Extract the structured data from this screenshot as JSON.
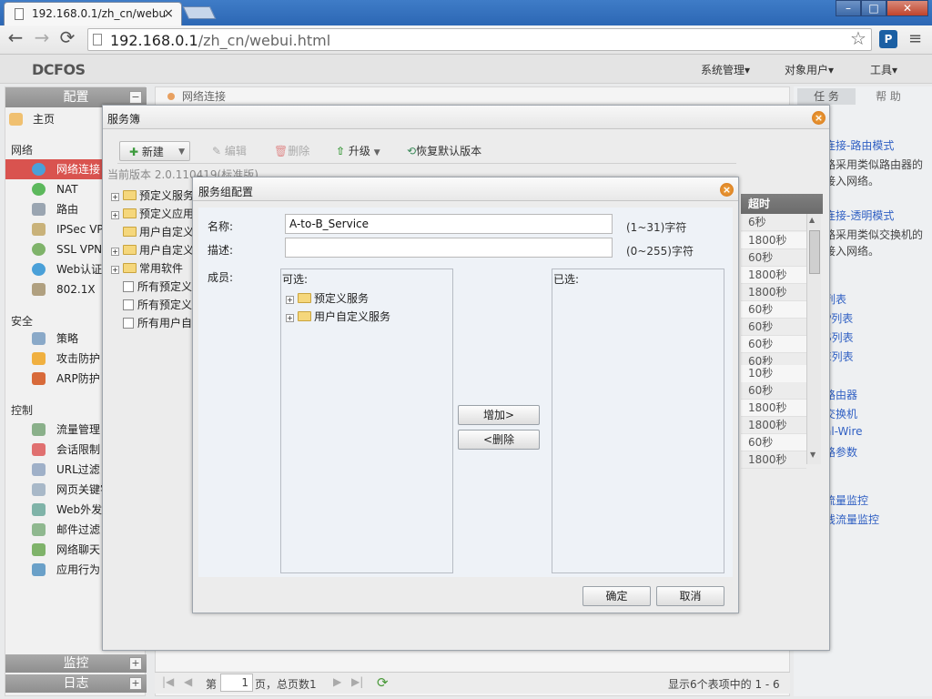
{
  "browser": {
    "tab_title": "192.168.0.1/zh_cn/webu",
    "url_host": "192.168.0.1",
    "url_path": "/zh_cn/webui.html",
    "back_icon": "←",
    "forward_icon": "→",
    "reload_icon": "⟳",
    "tab_close": "×",
    "star_icon": "☆",
    "menu_icon": "≡",
    "win_min": "–",
    "win_max": "□",
    "win_close": "✕"
  },
  "app": {
    "logo": "DCFOS",
    "top_menu": [
      "系统管理▾",
      "对象用户▾",
      "工具▾"
    ]
  },
  "left_panel": {
    "header": "配置",
    "home": "主页",
    "sections": {
      "network": "网络",
      "security": "安全",
      "control": "控制"
    },
    "network_items": [
      "网络连接",
      "NAT",
      "路由",
      "IPSec VPN",
      "SSL VPN",
      "Web认证",
      "802.1X"
    ],
    "security_items": [
      "策略",
      "攻击防护",
      "ARP防护"
    ],
    "control_items": [
      "流量管理",
      "会话限制",
      "URL过滤",
      "网页关键字",
      "Web外发",
      "邮件过滤",
      "网络聊天",
      "应用行为"
    ],
    "footer_monitor": "监控",
    "footer_log": "日志",
    "plus": "+",
    "minus": "−"
  },
  "center": {
    "breadcrumb": "网络连接",
    "pager": {
      "page_prefix": "第",
      "page_value": "1",
      "page_suffix": "页，总页数1",
      "summary": "显示6个表项中的 1 - 6"
    }
  },
  "right_panel": {
    "tab_tasks": "任 务",
    "tab_help": "帮 助",
    "lines": [
      {
        "text": "连接-路由模式",
        "link": true
      },
      {
        "text": "路采用类似路由器的",
        "link": false
      },
      {
        "text": "接入网络。",
        "link": false
      },
      {
        "text": "连接-透明模式",
        "link": true
      },
      {
        "text": "路采用类似交换机的",
        "link": false
      },
      {
        "text": "接入网络。",
        "link": false
      },
      {
        "text": "列表",
        "link": true
      },
      {
        "text": "P列表",
        "link": true
      },
      {
        "text": "S列表",
        "link": true
      },
      {
        "text": "E列表",
        "link": true
      },
      {
        "text": "路由器",
        "link": true
      },
      {
        "text": "交换机",
        "link": true
      },
      {
        "text": "al-Wire",
        "link": true
      },
      {
        "text": "路参数",
        "link": true
      },
      {
        "text": "流量监控",
        "link": true
      },
      {
        "text": "线流量监控",
        "link": true
      }
    ]
  },
  "service_book": {
    "title": "服务簿",
    "close": "×",
    "toolbar": {
      "new": "新建",
      "edit": "编辑",
      "delete": "删除",
      "upgrade": "升级",
      "restore": "恢复默认版本"
    },
    "version": "当前版本 2.0.110419(标准版)",
    "tree": [
      {
        "label": "预定义服务",
        "type": "folder",
        "expand": true
      },
      {
        "label": "预定义应用",
        "type": "folder",
        "expand": true
      },
      {
        "label": "用户自定义",
        "type": "folder",
        "expand": false
      },
      {
        "label": "用户自定义",
        "type": "folder",
        "expand": true
      },
      {
        "label": "常用软件",
        "type": "folder",
        "expand": true
      },
      {
        "label": "所有预定义",
        "type": "doc",
        "expand": false
      },
      {
        "label": "所有预定义",
        "type": "doc",
        "expand": false
      },
      {
        "label": "所有用户自",
        "type": "doc",
        "expand": false
      }
    ],
    "grid": {
      "header": "超时",
      "cells": [
        "6秒",
        "1800秒",
        "60秒",
        "1800秒",
        "1800秒",
        "60秒",
        "60秒",
        "60秒",
        "60秒",
        "10秒",
        "60秒",
        "1800秒",
        "1800秒",
        "60秒",
        "1800秒"
      ]
    }
  },
  "group_dialog": {
    "title": "服务组配置",
    "close": "×",
    "name_label": "名称:",
    "name_value": "A-to-B_Service",
    "name_hint": "(1~31)字符",
    "desc_label": "描述:",
    "desc_value": "",
    "desc_hint": "(0~255)字符",
    "member_label": "成员:",
    "available_label": "可选:",
    "selected_label": "已选:",
    "available_items": [
      "预定义服务",
      "用户自定义服务"
    ],
    "add_button": "增加>",
    "remove_button": "<删除",
    "ok_button": "确定",
    "cancel_button": "取消"
  },
  "colors": {
    "titlebar": "#2c67b4",
    "selected_nav": "#d9534f",
    "link": "#2f5fc3",
    "close_orange": "#e08a2a"
  }
}
